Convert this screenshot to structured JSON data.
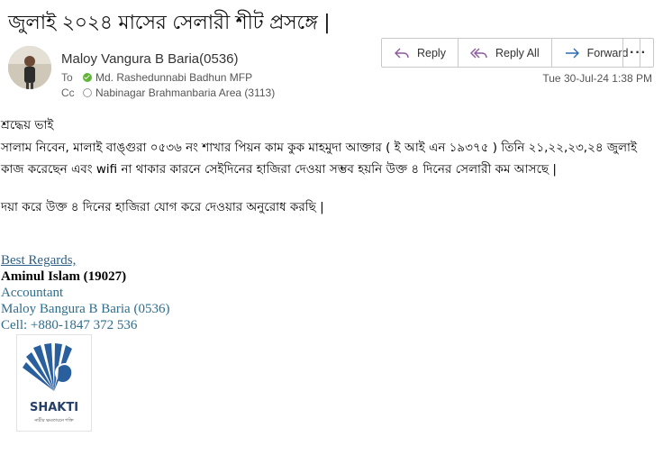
{
  "email": {
    "subject": "জুলাই ২০২৪ মাসের সেলারী শীট প্রসঙ্গে |",
    "sender": "Maloy Vangura B Baria(0536)",
    "to_label": "To",
    "to_value": "Md. Rashedunnabi Badhun MFP",
    "cc_label": "Cc",
    "cc_value": "Nabinagar Brahmanbaria Area (3113)",
    "date": "Tue 30-Jul-24 1:38 PM"
  },
  "toolbar": {
    "reply_label": "Reply",
    "reply_all_label": "Reply All",
    "forward_label": "Forward",
    "more_label": "···"
  },
  "body": {
    "greeting": "শ্রদ্ধেয় ভাই",
    "line1": "সালাম নিবেন, মালাই বাঙ্গুরা ০৫৩৬ নং শাখার পিয়ন কাম কুক মাহমুদা আক্তার ( ই আই এন ১৯৩৭৫ ) তিনি ২১,২২,২৩,২৪ জুলাই",
    "line2": "কাজ করেছেন এবং wifi না থাকার কারনে সেইদিনের হাজিরা দেওয়া সম্ভব হয়নি উক্ত ৪ দিনের সেলারী কম আসছে |",
    "line3": "দয়া করে উক্ত ৪ দিনের হাজিরা যোগ করে দেওয়ার অনুরোধ করছি |"
  },
  "signature": {
    "regards": "Best Regards,",
    "name": "Aminul Islam (19027)",
    "title": "Accountant",
    "branch": "Maloy Bangura B Baria (0536)",
    "cell": "Cell: +880-1847 372 536"
  },
  "logo": {
    "name": "SHAKTI",
    "tagline": "নারীর ক্ষমতায়নে শক্তি"
  },
  "colors": {
    "link": "#2e5f86",
    "accent": "#0078d4",
    "logo_blue": "#2a5f9e"
  }
}
